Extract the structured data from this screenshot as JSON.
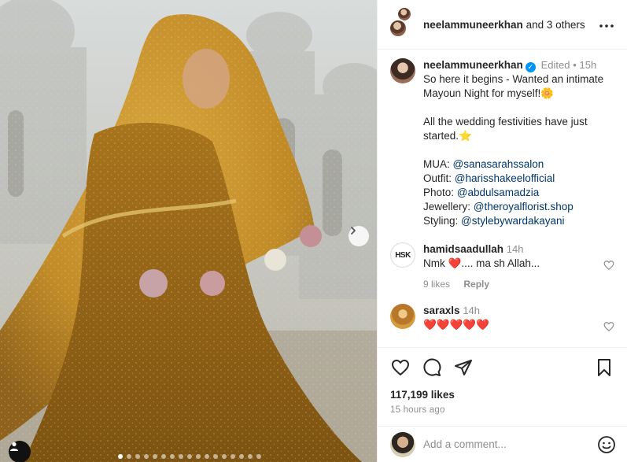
{
  "header": {
    "username": "neelammuneerkhan",
    "others": "and 3 others"
  },
  "caption": {
    "username": "neelammuneerkhan",
    "edited": "Edited",
    "time": "15h",
    "line1": "So here it begins - Wanted an intimate Mayoun Night for myself!🌼",
    "line2": "All the wedding festivities have just started.⭐",
    "mua_label": "MUA:",
    "mua": "@sanasarahssalon",
    "outfit_label": "Outfit:",
    "outfit": "@harisshakeelofficial",
    "photo_label": "Photo:",
    "photo": "@abdulsamadzia",
    "jewellery_label": "Jewellery:",
    "jewellery": "@theroyalflorist.shop",
    "styling_label": "Styling:",
    "styling": "@stylebywardakayani"
  },
  "comments": [
    {
      "username": "hamidsaadullah",
      "time": "14h",
      "avatar_text": "HSK",
      "text_before": "Nmk",
      "emoji": "❤️",
      "text_after": ".... ma sh Allah...",
      "likes": "9 likes",
      "reply": "Reply"
    },
    {
      "username": "saraxls",
      "time": "14h",
      "text": "❤️❤️❤️❤️❤️"
    }
  ],
  "actions": {
    "likes": "117,199 likes",
    "time_ago": "15 hours ago"
  },
  "add_comment": {
    "placeholder": "Add a comment..."
  },
  "icons": {
    "like": "heart-icon",
    "comment": "comment-icon",
    "share": "paper-plane-icon",
    "save": "bookmark-icon",
    "more": "more-options-icon",
    "next": "chevron-right-icon",
    "tag": "user-tag-icon",
    "emoji": "emoji-icon"
  }
}
